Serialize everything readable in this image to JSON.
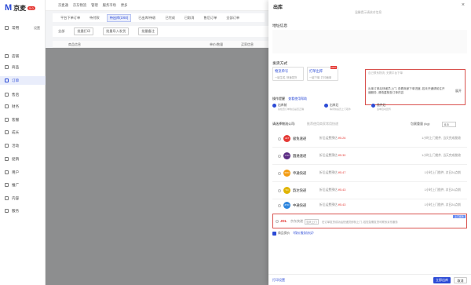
{
  "logo": {
    "mark": "M",
    "text": "京麦",
    "badge": "5.0"
  },
  "sidebar": {
    "items": [
      {
        "label": "常用",
        "sub": "设置"
      },
      {
        "label": "店铺"
      },
      {
        "label": "商品"
      },
      {
        "label": "订单"
      },
      {
        "label": "售后"
      },
      {
        "label": "财务"
      },
      {
        "label": "客服"
      },
      {
        "label": "成长"
      },
      {
        "label": "活动"
      },
      {
        "label": "促销"
      },
      {
        "label": "用户"
      },
      {
        "label": "推广"
      },
      {
        "label": "内容"
      },
      {
        "label": "服务"
      }
    ]
  },
  "topnav": {
    "items": [
      "京麦通",
      "京东物流",
      "管理",
      "服务市场",
      "更多"
    ]
  },
  "tabs": [
    "平台下单订单",
    "待付款",
    "待出库(1/60)",
    "已出库/待收",
    "已完成",
    "已取消",
    "售后订单",
    "全部订单"
  ],
  "subtoolbar": {
    "items": [
      "全部",
      "批量打印",
      "批量导入发货",
      "批量备注"
    ]
  },
  "grid": {
    "col1": "商品信息",
    "col2": "单价/数量",
    "col3": "买家信息"
  },
  "drawer": {
    "title": "出库",
    "close": "×",
    "hint": "温馨提示请核对信息",
    "address_title": "地址信息",
    "shipping_title": "发货方式",
    "modes": [
      {
        "title": "物流单号",
        "desc": "一键生成, 快速发货",
        "hot": ""
      },
      {
        "title": "打单出库",
        "desc": "一键下单, 打印面单",
        "hot": "HOT"
      }
    ],
    "box_hint": "自己联系物流, 无需平台下单",
    "guide": "出库订单后快递员上门, 查看商家下单进度, 若未开通请前往开通服务, 请慎重核查订单内容",
    "expand": "展开",
    "ops_title": "操作提醒",
    "ops_link": "查看使用帮助",
    "ops": [
      {
        "label": "出库前",
        "desc": "先检查订单信息是否正确"
      },
      {
        "label": "出库后",
        "desc": "等待快递员上门取件"
      },
      {
        "label": "揽件后",
        "desc": "运单自动回传"
      }
    ],
    "select_label": "请选择物流公司:",
    "select_note": "推荐使用商家常用快递",
    "weight_label": "包裹重量 (kg):",
    "weight_value": "0.5",
    "couriers": [
      {
        "name": "极兔速递",
        "fee_label": "折后运费预估",
        "fee": "¥5.26",
        "info": "1小时上门揽件, 当天完成揽收",
        "color": "#e53935",
        "logo": "J&T"
      },
      {
        "name": "圆通速递",
        "fee_label": "折后运费预估",
        "fee": "¥5.30",
        "info": "1小时上门揽件, 当天完成揽收",
        "color": "#5b2c83",
        "logo": "YTO"
      },
      {
        "name": "申通快递",
        "fee_label": "折后运费预估",
        "fee": "¥5.47",
        "info": "1小时上门揽件, 次日24点前",
        "color": "#f39c12",
        "logo": "STO"
      },
      {
        "name": "韵达快递",
        "fee_label": "折后运费预估",
        "fee": "¥5.43",
        "info": "1小时上门揽件, 次日24点前",
        "color": "#f1c40f",
        "logo": "YD"
      },
      {
        "name": "中通快递",
        "fee_label": "折后运费预估",
        "fee": "¥5.43",
        "info": "1小时上门揽件, 次日24点前",
        "color": "#2e86de",
        "logo": "ZTO"
      }
    ],
    "jd": {
      "logo": "JDL",
      "name": "京东快递",
      "tag": "当天上门",
      "desc": "在订单发货成功后快递员即刻上门, 若您急需发货可联系京东服务",
      "badge": "上门揽件"
    },
    "privacy_label": "商品保价",
    "privacy_link": "《保价服务协议》",
    "footer_link": "打印设置",
    "confirm": "立即出库",
    "cancel": "取消"
  }
}
